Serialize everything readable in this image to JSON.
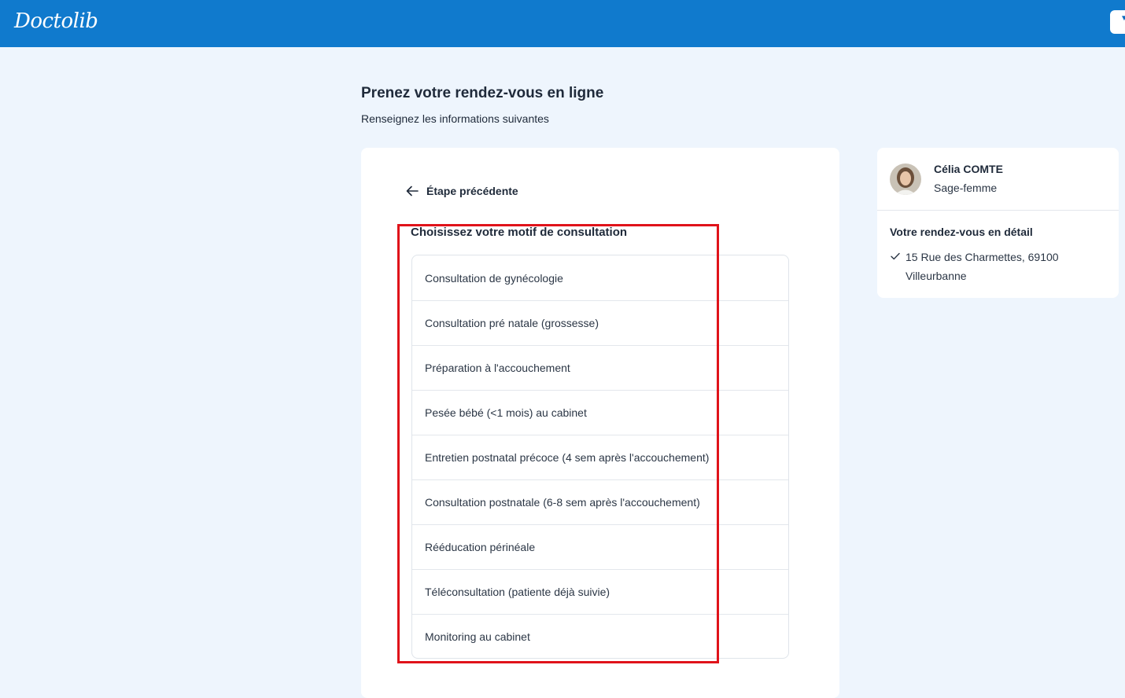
{
  "header": {
    "logo_text": "Doctolib",
    "right_button_glyph": "▼",
    "brand_color": "#107acd"
  },
  "page": {
    "title": "Prenez votre rendez-vous en ligne",
    "subtitle": "Renseignez les informations suivantes"
  },
  "form": {
    "back_label": "Étape précédente",
    "section_title": "Choisissez votre motif de consultation",
    "motifs": [
      "Consultation de gynécologie",
      "Consultation pré natale (grossesse)",
      "Préparation à l'accouchement",
      "Pesée bébé (<1 mois) au cabinet",
      "Entretien postnatal précoce (4 sem après l'accouchement)",
      "Consultation postnatale (6-8 sem après l'accouchement)",
      "Rééducation périnéale",
      "Téléconsultation (patiente déjà suivie)",
      "Monitoring au cabinet"
    ]
  },
  "practitioner": {
    "name": "Célia COMTE",
    "specialty": "Sage-femme"
  },
  "appointment": {
    "title": "Votre rendez-vous en détail",
    "address": "15 Rue des Charmettes, 69100 Villeurbanne"
  },
  "icons": {
    "back": "arrow-left-icon",
    "check": "check-icon",
    "menu": "chevron-down-icon"
  },
  "highlight_color": "#e0131a"
}
